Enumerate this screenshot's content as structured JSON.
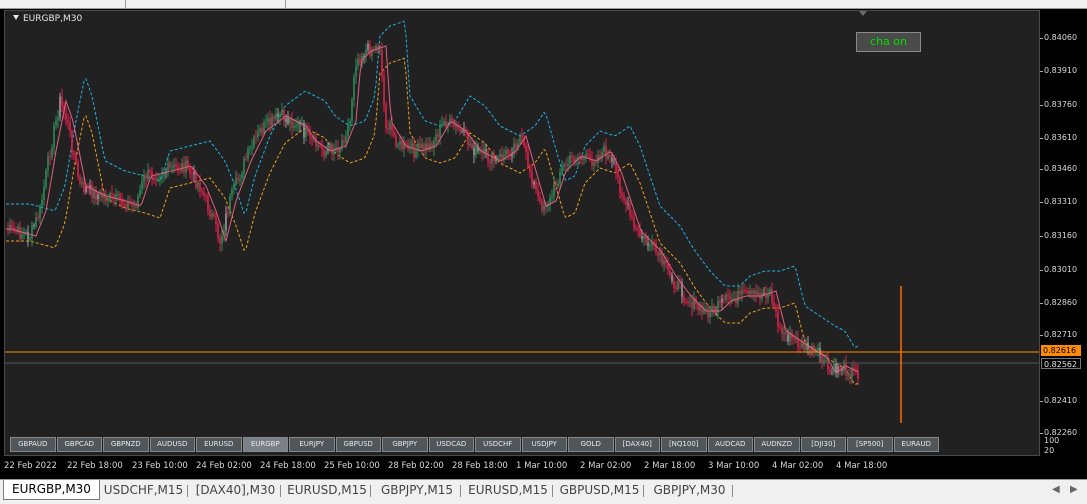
{
  "chart": {
    "title": "EURGBP,M30",
    "indicator_button": "cha on",
    "colors": {
      "bull": "#2e8b57",
      "bear": "#e0204a",
      "neutral": "#9a9a9a",
      "price_line": "#ff8c00",
      "ma_fast": "#e06080",
      "band_upper": "#1fb3e8",
      "band_lower": "#f0a020",
      "signal": "#ff6a00"
    }
  },
  "yaxis": {
    "labels": [
      "0.84060",
      "0.83910",
      "0.83760",
      "0.83610",
      "0.83460",
      "0.83310",
      "0.83160",
      "0.83010",
      "0.82860",
      "0.82710",
      "0.82410",
      "0.82260"
    ],
    "current_price": "0.82616",
    "bid_price": "0.82562",
    "sub_labels": [
      "100",
      "20"
    ]
  },
  "xaxis": {
    "labels": [
      "22 Feb 2022",
      "22 Feb 18:00",
      "23 Feb 10:00",
      "24 Feb 02:00",
      "24 Feb 18:00",
      "25 Feb 10:00",
      "28 Feb 02:00",
      "28 Feb 18:00",
      "1 Mar 10:00",
      "2 Mar 02:00",
      "2 Mar 18:00",
      "3 Mar 10:00",
      "4 Mar 02:00",
      "4 Mar 18:00"
    ]
  },
  "symbol_buttons": [
    "GBPAUD",
    "GBPCAD",
    "GBPNZD",
    "AUDUSD",
    "EURUSD",
    "EURGBP",
    "EURJPY",
    "GBPUSD",
    "GBPJPY",
    "USDCAD",
    "USDCHF",
    "USDJPY",
    "GOLD",
    "[DAX40]",
    "[NQ100]",
    "AUDCAD",
    "AUDNZD",
    "[DJI30]",
    "[SP500]",
    "EURAUD"
  ],
  "active_symbol": "EURGBP",
  "tabs": [
    "EURGBP,M30",
    "USDCHF,M15",
    "[DAX40],M30",
    "EURUSD,M15",
    "GBPJPY,M15",
    "EURUSD,M15",
    "GBPUSD,M15",
    "GBPJPY,M30"
  ],
  "tab_nav": {
    "left": "◀",
    "right": "▶"
  }
}
